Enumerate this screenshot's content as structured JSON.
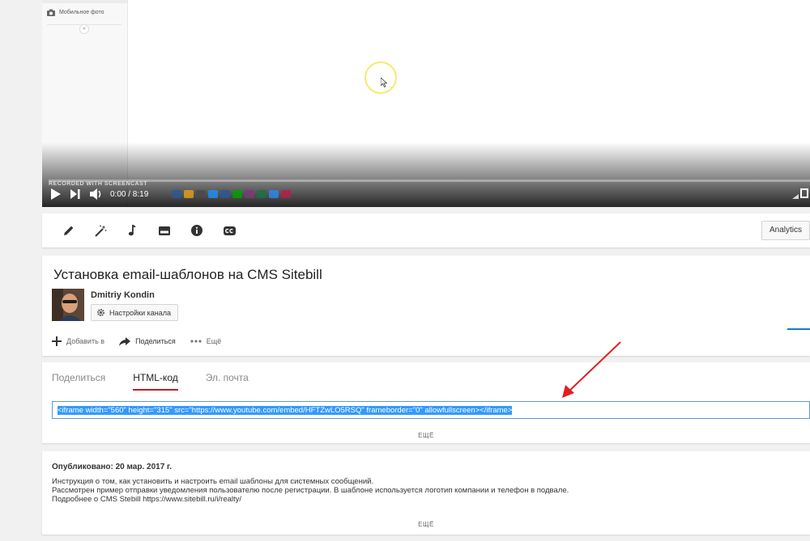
{
  "player": {
    "sidebar_item": "Мобильное фото",
    "collapse_glyph": "«",
    "watermark": "RECORDED WITH SCREENCAST",
    "time": "0:00 / 8:19",
    "progress": 0,
    "taskbar_colors": [
      "#2b5797",
      "#e3a21a",
      "#4a4a4a",
      "#1e90ff",
      "#2b5797",
      "#00a300",
      "#7e3878",
      "#1d7044",
      "#2d89ef",
      "#b91d47"
    ]
  },
  "toolbar": {
    "icons": [
      "pencil-icon",
      "magic-wand-icon",
      "music-note-icon",
      "card-icon",
      "info-icon",
      "cc-icon"
    ],
    "analytics_label": "Analytics"
  },
  "video": {
    "title": "Установка email-шаблонов на CMS Sitebill",
    "channel_name": "Dmitriy Kondin",
    "channel_settings_label": "Настройки канала",
    "actions": {
      "add_label": "Добавить в",
      "share_label": "Поделиться",
      "more_label": "Ещё"
    }
  },
  "share": {
    "tabs": [
      "Поделиться",
      "HTML-код",
      "Эл. почта"
    ],
    "active_tab": 1,
    "embed_code": "<iframe width=\"560\" height=\"315\" src=\"https://www.youtube.com/embed/HFTZwLO5RSQ\" frameborder=\"0\" allowfullscreen></iframe>",
    "more_label": "ЕЩЁ"
  },
  "description": {
    "published": "Опубликовано: 20 мар. 2017 г.",
    "lines": [
      "Инструкция о том, как установить и настроить email шаблоны для системных сообщений.",
      "Рассмотрен пример отправки уведомления пользователю после регистрации. В шаблоне используется логотип компании и телефон в подвале.",
      "Подробнее о CMS Stebill https://www.sitebill.ru/i/realty/"
    ],
    "more_label": "ЕЩЁ"
  },
  "colors": {
    "accent_red": "#cc181e",
    "selection_blue": "#3399ff",
    "annotation_red": "#e02020"
  }
}
